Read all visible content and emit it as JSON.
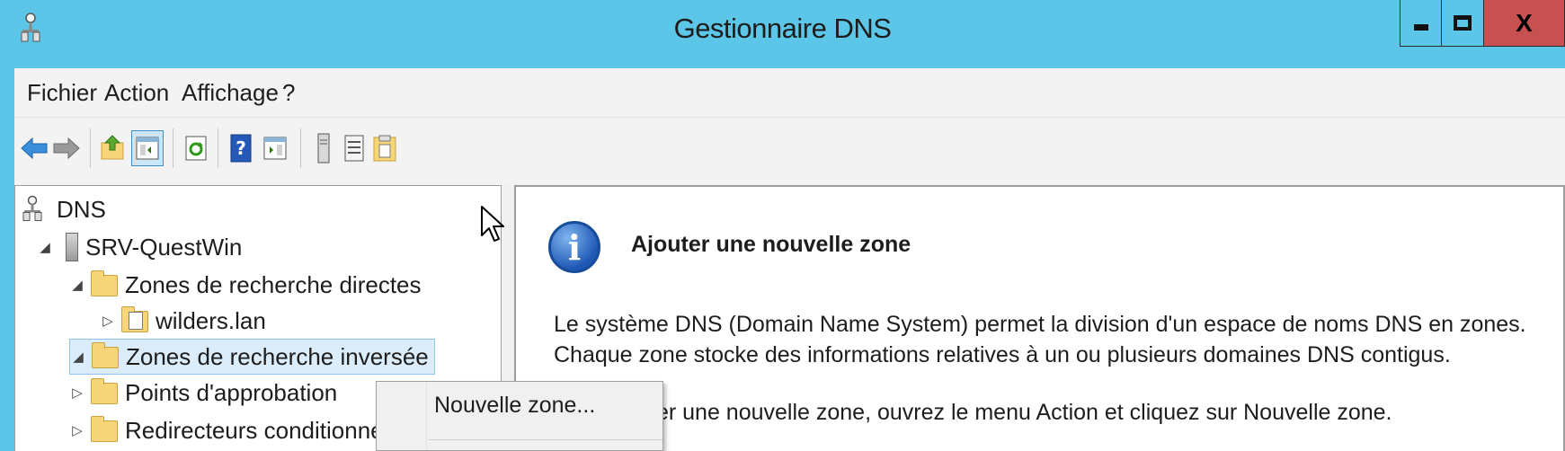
{
  "window": {
    "title": "Gestionnaire DNS",
    "close_glyph": "X",
    "title_color": "#5bc6e8",
    "close_color": "#c75050"
  },
  "menubar": {
    "items": [
      "Fichier",
      "Action",
      "Affichage",
      "?"
    ]
  },
  "toolbar": {
    "buttons": [
      "back-arrow-icon",
      "forward-arrow-icon",
      "up-folder-icon",
      "show-hide-console-tree-icon",
      "refresh-icon",
      "help-icon",
      "action-pane-icon",
      "server-icon",
      "list-icon",
      "zone-properties-icon"
    ]
  },
  "tree": {
    "root": "DNS",
    "server": "SRV-QuestWin",
    "forward_zones": "Zones de recherche directes",
    "forward_child": "wilders.lan",
    "reverse_zones": "Zones de recherche inversée",
    "trust_points": "Points d'approbation",
    "conditional_forwarders": "Redirecteurs conditionnels"
  },
  "detail": {
    "heading": "Ajouter une nouvelle zone",
    "paragraph1": "Le système DNS (Domain Name System) permet la division d'un espace de noms DNS en zones. Chaque zone stocke des informations relatives à un ou plusieurs domaines DNS contigus.",
    "paragraph2": "Pour ajouter une nouvelle zone, ouvrez le menu Action et cliquez sur Nouvelle zone."
  },
  "context_menu": {
    "items": [
      "Nouvelle zone..."
    ]
  }
}
